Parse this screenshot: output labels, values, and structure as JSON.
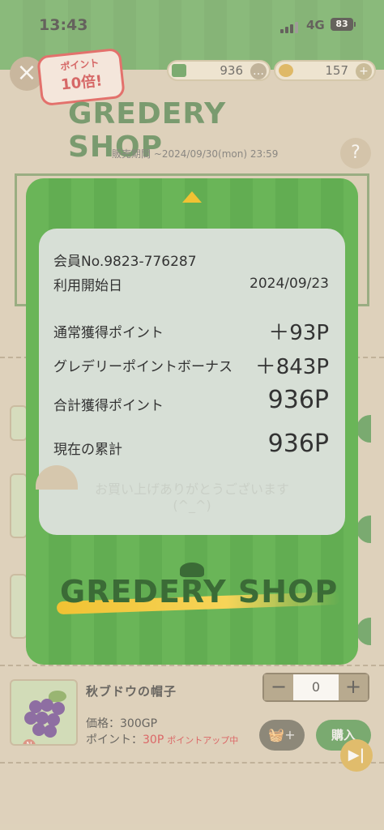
{
  "status_bar": {
    "time": "13:43",
    "network": "4G",
    "battery": "83"
  },
  "header": {
    "badge_line1": "ポイント",
    "badge_line2": "10倍!",
    "gp_balance": "936",
    "coin_balance": "157",
    "logo": "GREDERY SHOP",
    "sale_period": "販売期間 ~2024/09/30(mon) 23:59",
    "help_label": "?"
  },
  "modal": {
    "member_line": "会員No.9823-776287",
    "start_label": "利用開始日",
    "start_date": "2024/09/23",
    "rows": [
      {
        "label": "通常獲得ポイント",
        "value": "＋93P"
      },
      {
        "label": "グレデリーポイントボーナス",
        "value": "＋843P"
      },
      {
        "label": "合計獲得ポイント",
        "value": "936P"
      },
      {
        "label": "現在の累計",
        "value": "936P"
      }
    ],
    "thanks_line1": "お買い上げありがとうございます",
    "thanks_line2": "(^_^)",
    "logo": "GREDERY SHOP"
  },
  "product": {
    "name": "秋ブドウの帽子",
    "price": "価格：300GP",
    "points_label": "ポイント：",
    "points_value": "30P",
    "points_up": "ポイントアップ中",
    "quantity": "0",
    "buy_label": "購入",
    "n_badge": "N"
  },
  "colors": {
    "brand_green": "#3c8a3a",
    "modal_green": "#6ab558",
    "accent_yellow": "#f1c233",
    "points_red": "#d2232a"
  }
}
